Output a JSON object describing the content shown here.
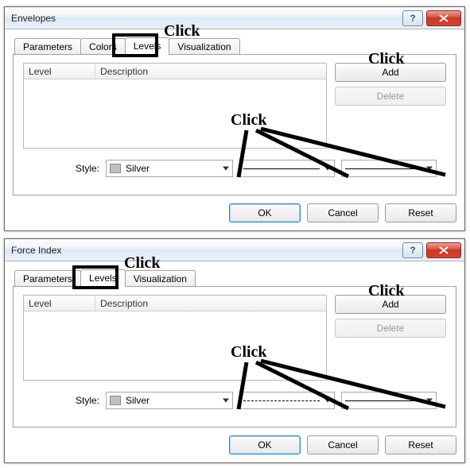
{
  "annotations": {
    "click": "Click"
  },
  "dialogs": [
    {
      "title": "Envelopes",
      "tabs": [
        "Parameters",
        "Colors",
        "Levels",
        "Visualization"
      ],
      "active_tab_index": 2,
      "columns": {
        "level": "Level",
        "description": "Description"
      },
      "buttons": {
        "add": "Add",
        "delete": "Delete"
      },
      "style_label": "Style:",
      "color_name": "Silver",
      "color_hex": "#c0c0c0",
      "line_style": "solid",
      "dialog_buttons": {
        "ok": "OK",
        "cancel": "Cancel",
        "reset": "Reset"
      }
    },
    {
      "title": "Force Index",
      "tabs": [
        "Parameters",
        "Levels",
        "Visualization"
      ],
      "active_tab_index": 1,
      "columns": {
        "level": "Level",
        "description": "Description"
      },
      "buttons": {
        "add": "Add",
        "delete": "Delete"
      },
      "style_label": "Style:",
      "color_name": "Silver",
      "color_hex": "#c0c0c0",
      "line_style": "dashed",
      "dialog_buttons": {
        "ok": "OK",
        "cancel": "Cancel",
        "reset": "Reset"
      }
    }
  ]
}
